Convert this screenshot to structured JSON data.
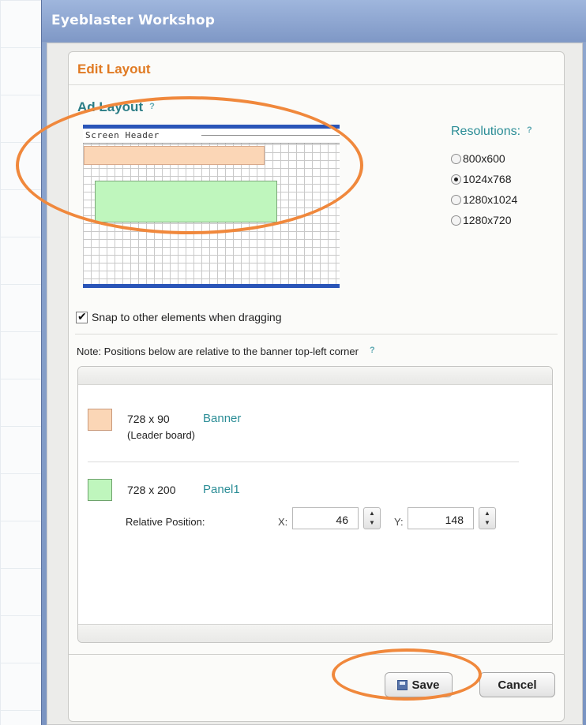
{
  "window": {
    "title": "Eyeblaster Workshop"
  },
  "panel": {
    "title": "Edit Layout"
  },
  "ad_layout": {
    "title": "Ad Layout",
    "help": "?",
    "preview": {
      "screen_header": "Screen Header"
    }
  },
  "resolutions": {
    "title": "Resolutions:",
    "help": "?",
    "options": [
      {
        "label": "800x600",
        "checked": false
      },
      {
        "label": "1024x768",
        "checked": true
      },
      {
        "label": "1280x1024",
        "checked": false
      },
      {
        "label": "1280x720",
        "checked": false
      }
    ]
  },
  "snap": {
    "label": "Snap to other elements when dragging",
    "checked": true
  },
  "note": {
    "text": "Note: Positions below are relative to the banner top-left corner",
    "help": "?"
  },
  "items": [
    {
      "size": "728 x 90",
      "name": "Banner",
      "sub": "(Leader board)",
      "color": "#fbd6b6"
    },
    {
      "size": "728 x 200",
      "name": "Panel1",
      "color": "#bff6bd",
      "relative_label": "Relative Position:",
      "x_label": "X:",
      "x_value": "46",
      "y_label": "Y:",
      "y_value": "148"
    }
  ],
  "buttons": {
    "save": "Save",
    "cancel": "Cancel"
  },
  "colors": {
    "accent_orange": "#e07a22",
    "teal": "#2b8d96",
    "highlight": "#f0883c"
  }
}
